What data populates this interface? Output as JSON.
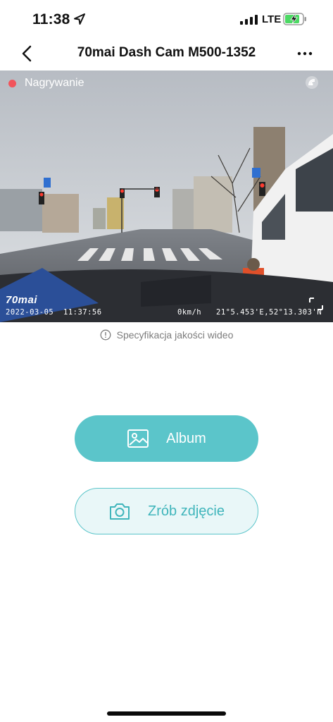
{
  "status_bar": {
    "time": "11:38",
    "network": "LTE",
    "icons": [
      "location-arrow-icon",
      "cellular-signal-icon",
      "battery-charging-icon"
    ]
  },
  "nav": {
    "title": "70mai Dash Cam M500-1352",
    "back_icon": "chevron-left-icon",
    "more_icon": "more-dots-icon"
  },
  "video": {
    "status": "Nagrywanie",
    "brand": "70mai",
    "date": "2022-03-05",
    "time": "11:37:56",
    "speed": "0km/h",
    "gps": "21°5.453'E,52°13.303'N",
    "colors": {
      "recording_dot": "#f2545b"
    }
  },
  "quality_note": "Specyfikacja jakości wideo",
  "buttons": {
    "album_label": "Album",
    "photo_label": "Zrób zdjęcie"
  },
  "colors": {
    "accent": "#5bc5ca",
    "accent_light": "#e9f7f8"
  }
}
